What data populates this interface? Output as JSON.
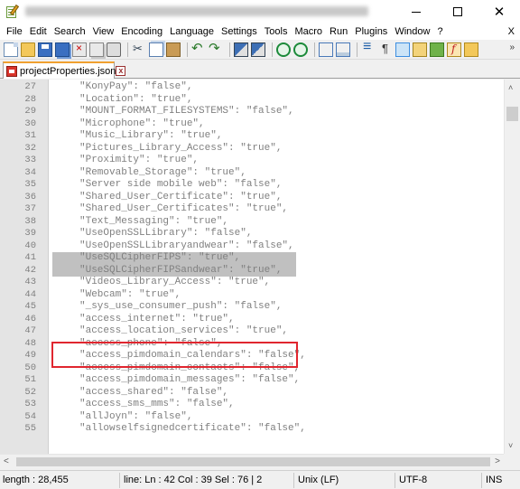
{
  "window": {
    "title": "",
    "minimize_icon": "minimize-icon",
    "maximize_icon": "maximize-icon",
    "close_icon": "close-icon"
  },
  "menu": {
    "items": [
      "File",
      "Edit",
      "Search",
      "View",
      "Encoding",
      "Language",
      "Settings",
      "Tools",
      "Macro",
      "Run",
      "Plugins",
      "Window",
      "?"
    ],
    "close_label": "X"
  },
  "toolbar": {
    "overflow_label": "»",
    "buttons": [
      "new-file",
      "open-file",
      "save",
      "save-all",
      "close",
      "close-all",
      "print",
      "cut",
      "copy",
      "paste",
      "undo",
      "redo",
      "find",
      "replace",
      "zoom-in",
      "zoom-out",
      "sync-vertical",
      "sync-horizontal",
      "word-wrap",
      "show-all-characters",
      "indent-guide",
      "user-language",
      "macro",
      "function-list",
      "folder-as-workspace"
    ]
  },
  "tab": {
    "label": "projectProperties.json",
    "close_glyph": "x"
  },
  "editor": {
    "lines": [
      {
        "n": "27",
        "text": "\"KonyPay\": \"false\","
      },
      {
        "n": "28",
        "text": "\"Location\": \"true\","
      },
      {
        "n": "29",
        "text": "\"MOUNT_FORMAT_FILESYSTEMS\": \"false\","
      },
      {
        "n": "30",
        "text": "\"Microphone\": \"true\","
      },
      {
        "n": "31",
        "text": "\"Music_Library\": \"true\","
      },
      {
        "n": "32",
        "text": "\"Pictures_Library_Access\": \"true\","
      },
      {
        "n": "33",
        "text": "\"Proximity\": \"true\","
      },
      {
        "n": "34",
        "text": "\"Removable_Storage\": \"true\","
      },
      {
        "n": "35",
        "text": "\"Server side mobile web\": \"false\","
      },
      {
        "n": "36",
        "text": "\"Shared_User_Certificate\": \"true\","
      },
      {
        "n": "37",
        "text": "\"Shared_User_Certificates\": \"true\","
      },
      {
        "n": "38",
        "text": "\"Text_Messaging\": \"true\","
      },
      {
        "n": "39",
        "text": "\"UseOpenSSLLibrary\": \"false\","
      },
      {
        "n": "40",
        "text": "\"UseOpenSSLLibraryandwear\": \"false\","
      },
      {
        "n": "41",
        "text": "\"UseSQLCipherFIPS\": \"true\","
      },
      {
        "n": "42",
        "text": "\"UseSQLCipherFIPSandwear\": \"true\","
      },
      {
        "n": "43",
        "text": "\"Videos_Library_Access\": \"true\","
      },
      {
        "n": "44",
        "text": "\"Webcam\": \"true\","
      },
      {
        "n": "45",
        "text": "\"_sys_use_consumer_push\": \"false\","
      },
      {
        "n": "46",
        "text": "\"access_internet\": \"true\","
      },
      {
        "n": "47",
        "text": "\"access_location_services\": \"true\","
      },
      {
        "n": "48",
        "text": "\"access_phone\": \"false\","
      },
      {
        "n": "49",
        "text": "\"access_pimdomain_calendars\": \"false\","
      },
      {
        "n": "50",
        "text": "\"access_pimdomain_contacts\": \"false\","
      },
      {
        "n": "51",
        "text": "\"access_pimdomain_messages\": \"false\","
      },
      {
        "n": "52",
        "text": "\"access_shared\": \"false\","
      },
      {
        "n": "53",
        "text": "\"access_sms_mms\": \"false\","
      },
      {
        "n": "54",
        "text": "\"allJoyn\": \"false\","
      },
      {
        "n": "55",
        "text": "\"allowselfsignedcertificate\": \"false\","
      }
    ],
    "selected_line_numbers": [
      "41",
      "42"
    ],
    "highlight_color": "#e0262f",
    "selection_color": "#c0c0c0"
  },
  "scrollbars": {
    "up_glyph": "˄",
    "down_glyph": "˅",
    "left_glyph": "<",
    "right_glyph": ">"
  },
  "status": {
    "length": "length : 28,455",
    "position": "line: Ln : 42    Col : 39    Sel : 76 | 2",
    "eol": "Unix (LF)",
    "encoding": "UTF-8",
    "mode": "INS"
  }
}
